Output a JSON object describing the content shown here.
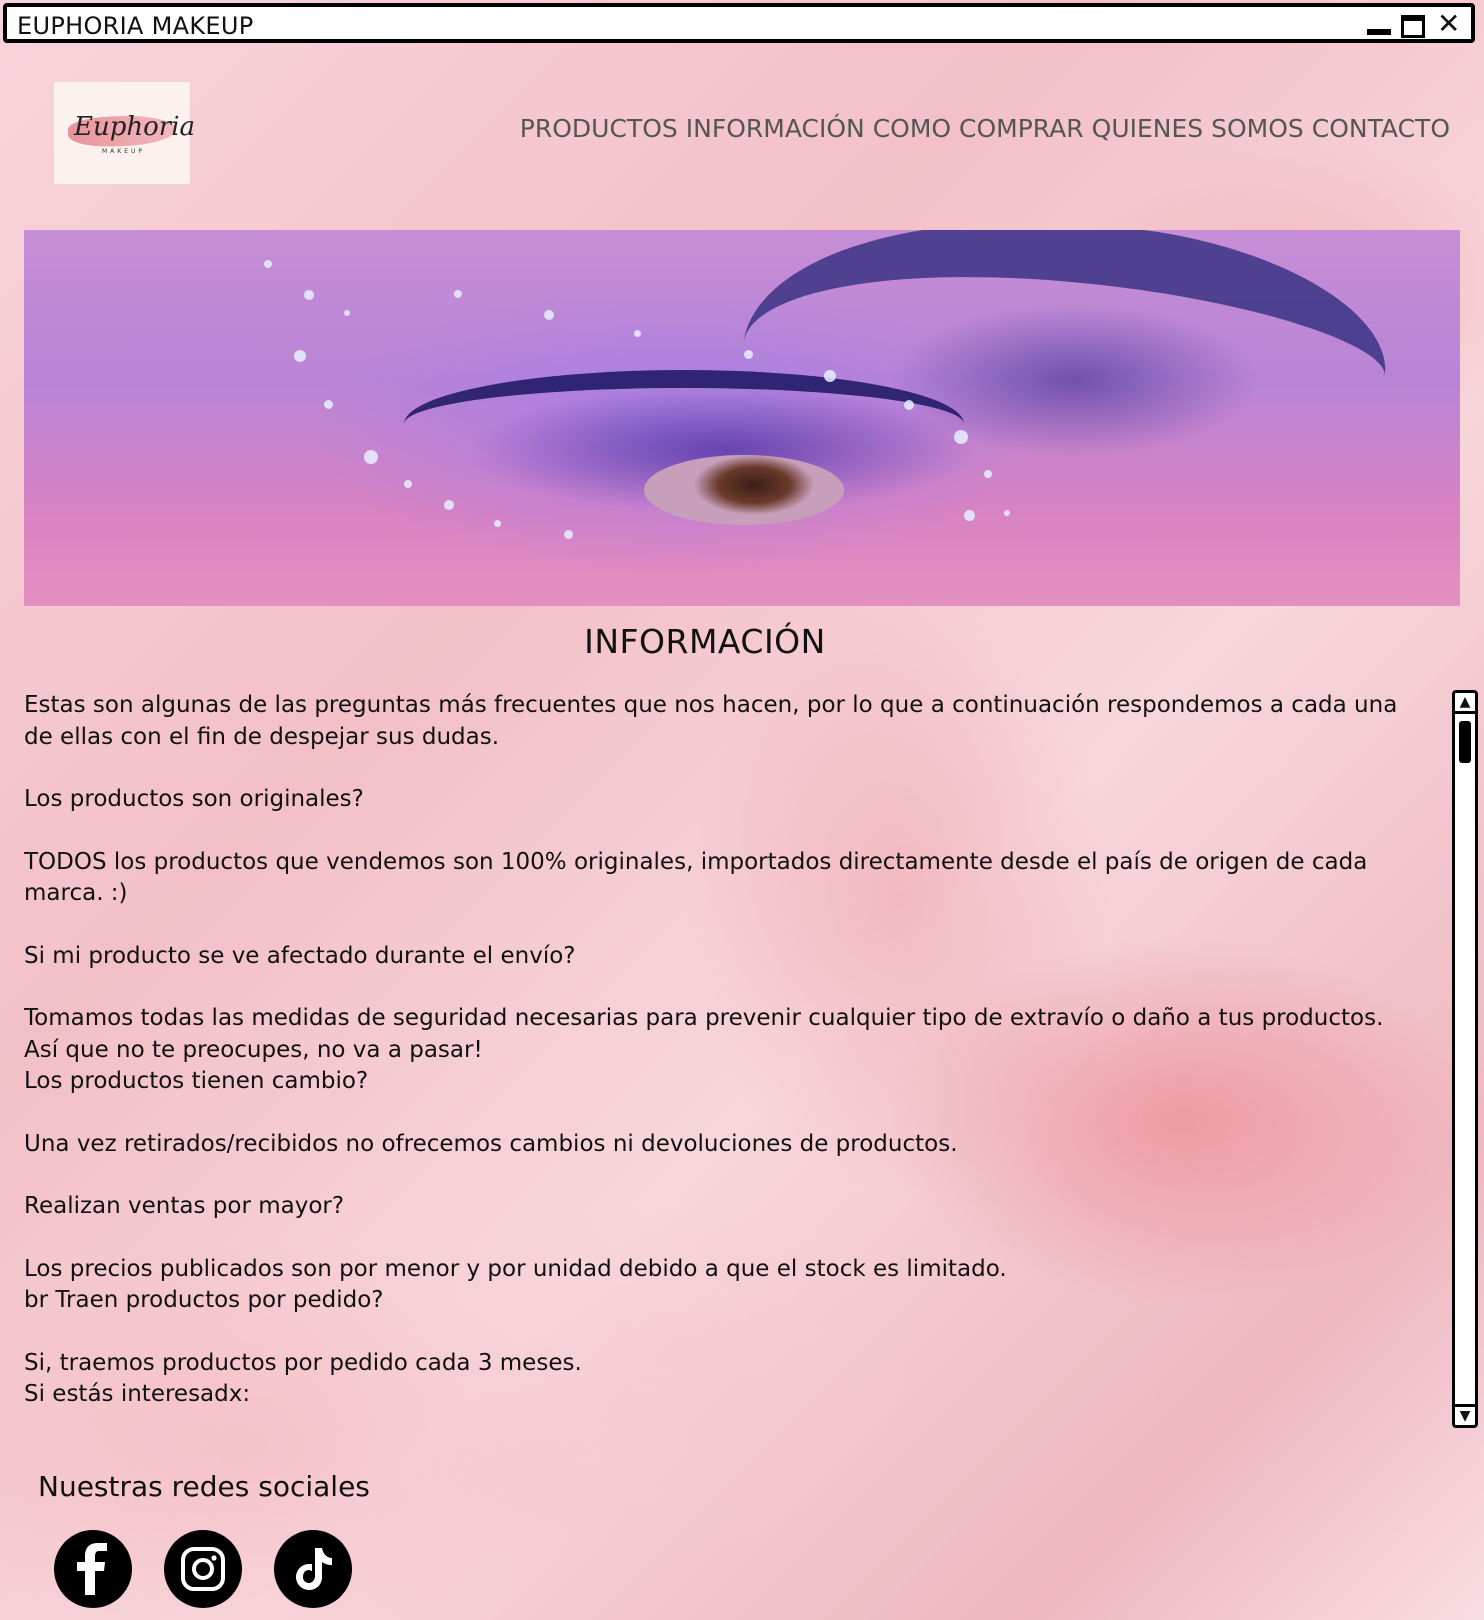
{
  "window": {
    "title": "EUPHORIA MAKEUP"
  },
  "logo": {
    "script_text": "Euphoria",
    "sub_text": "MAKEUP"
  },
  "nav": {
    "items": [
      "PRODUCTOS",
      "INFORMACIÓN",
      "COMO COMPRAR",
      "QUIENES SOMOS",
      "CONTACTO"
    ]
  },
  "section": {
    "title": "INFORMACIÓN"
  },
  "content": {
    "intro": "Estas son algunas de las preguntas más frecuentes que nos hacen, por lo que a continuación respondemos a cada una de ellas con el fin de despejar sus dudas.",
    "q1": "Los productos son originales?",
    "a1": "TODOS los productos que vendemos son 100% originales, importados directamente desde el país de origen de cada marca. :)",
    "q2": "Si mi producto se ve afectado durante el envío?",
    "a2_line1": "Tomamos todas las medidas de seguridad necesarias para prevenir cualquier tipo de extravío o daño a tus productos.",
    "a2_line2": "Así que no te preocupes, no va a pasar!",
    "q3": "Los productos tienen cambio?",
    "a3": "Una vez retirados/recibidos no ofrecemos cambios ni devoluciones de productos.",
    "q4": "Realizan ventas por mayor?",
    "a4": "Los precios publicados son por menor y por unidad debido a que el stock es limitado.",
    "q5": "br Traen productos por pedido?",
    "a5": "Si, traemos productos por pedido cada 3 meses.",
    "a5_line2": "Si estás interesadx:"
  },
  "social": {
    "title": "Nuestras redes sociales",
    "icons": [
      "facebook-icon",
      "instagram-icon",
      "tiktok-icon"
    ]
  }
}
